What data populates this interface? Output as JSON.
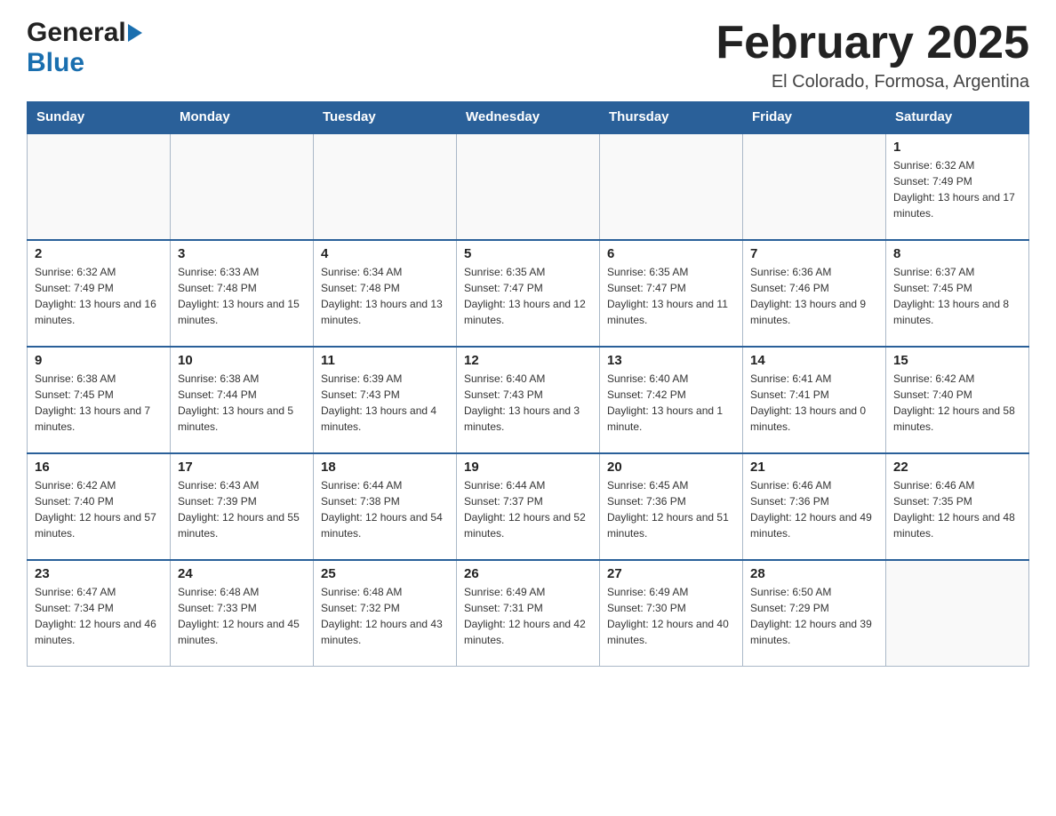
{
  "header": {
    "logo_general": "General",
    "logo_blue": "Blue",
    "month_title": "February 2025",
    "location": "El Colorado, Formosa, Argentina"
  },
  "weekdays": [
    "Sunday",
    "Monday",
    "Tuesday",
    "Wednesday",
    "Thursday",
    "Friday",
    "Saturday"
  ],
  "weeks": [
    [
      {
        "day": "",
        "sunrise": "",
        "sunset": "",
        "daylight": ""
      },
      {
        "day": "",
        "sunrise": "",
        "sunset": "",
        "daylight": ""
      },
      {
        "day": "",
        "sunrise": "",
        "sunset": "",
        "daylight": ""
      },
      {
        "day": "",
        "sunrise": "",
        "sunset": "",
        "daylight": ""
      },
      {
        "day": "",
        "sunrise": "",
        "sunset": "",
        "daylight": ""
      },
      {
        "day": "",
        "sunrise": "",
        "sunset": "",
        "daylight": ""
      },
      {
        "day": "1",
        "sunrise": "Sunrise: 6:32 AM",
        "sunset": "Sunset: 7:49 PM",
        "daylight": "Daylight: 13 hours and 17 minutes."
      }
    ],
    [
      {
        "day": "2",
        "sunrise": "Sunrise: 6:32 AM",
        "sunset": "Sunset: 7:49 PM",
        "daylight": "Daylight: 13 hours and 16 minutes."
      },
      {
        "day": "3",
        "sunrise": "Sunrise: 6:33 AM",
        "sunset": "Sunset: 7:48 PM",
        "daylight": "Daylight: 13 hours and 15 minutes."
      },
      {
        "day": "4",
        "sunrise": "Sunrise: 6:34 AM",
        "sunset": "Sunset: 7:48 PM",
        "daylight": "Daylight: 13 hours and 13 minutes."
      },
      {
        "day": "5",
        "sunrise": "Sunrise: 6:35 AM",
        "sunset": "Sunset: 7:47 PM",
        "daylight": "Daylight: 13 hours and 12 minutes."
      },
      {
        "day": "6",
        "sunrise": "Sunrise: 6:35 AM",
        "sunset": "Sunset: 7:47 PM",
        "daylight": "Daylight: 13 hours and 11 minutes."
      },
      {
        "day": "7",
        "sunrise": "Sunrise: 6:36 AM",
        "sunset": "Sunset: 7:46 PM",
        "daylight": "Daylight: 13 hours and 9 minutes."
      },
      {
        "day": "8",
        "sunrise": "Sunrise: 6:37 AM",
        "sunset": "Sunset: 7:45 PM",
        "daylight": "Daylight: 13 hours and 8 minutes."
      }
    ],
    [
      {
        "day": "9",
        "sunrise": "Sunrise: 6:38 AM",
        "sunset": "Sunset: 7:45 PM",
        "daylight": "Daylight: 13 hours and 7 minutes."
      },
      {
        "day": "10",
        "sunrise": "Sunrise: 6:38 AM",
        "sunset": "Sunset: 7:44 PM",
        "daylight": "Daylight: 13 hours and 5 minutes."
      },
      {
        "day": "11",
        "sunrise": "Sunrise: 6:39 AM",
        "sunset": "Sunset: 7:43 PM",
        "daylight": "Daylight: 13 hours and 4 minutes."
      },
      {
        "day": "12",
        "sunrise": "Sunrise: 6:40 AM",
        "sunset": "Sunset: 7:43 PM",
        "daylight": "Daylight: 13 hours and 3 minutes."
      },
      {
        "day": "13",
        "sunrise": "Sunrise: 6:40 AM",
        "sunset": "Sunset: 7:42 PM",
        "daylight": "Daylight: 13 hours and 1 minute."
      },
      {
        "day": "14",
        "sunrise": "Sunrise: 6:41 AM",
        "sunset": "Sunset: 7:41 PM",
        "daylight": "Daylight: 13 hours and 0 minutes."
      },
      {
        "day": "15",
        "sunrise": "Sunrise: 6:42 AM",
        "sunset": "Sunset: 7:40 PM",
        "daylight": "Daylight: 12 hours and 58 minutes."
      }
    ],
    [
      {
        "day": "16",
        "sunrise": "Sunrise: 6:42 AM",
        "sunset": "Sunset: 7:40 PM",
        "daylight": "Daylight: 12 hours and 57 minutes."
      },
      {
        "day": "17",
        "sunrise": "Sunrise: 6:43 AM",
        "sunset": "Sunset: 7:39 PM",
        "daylight": "Daylight: 12 hours and 55 minutes."
      },
      {
        "day": "18",
        "sunrise": "Sunrise: 6:44 AM",
        "sunset": "Sunset: 7:38 PM",
        "daylight": "Daylight: 12 hours and 54 minutes."
      },
      {
        "day": "19",
        "sunrise": "Sunrise: 6:44 AM",
        "sunset": "Sunset: 7:37 PM",
        "daylight": "Daylight: 12 hours and 52 minutes."
      },
      {
        "day": "20",
        "sunrise": "Sunrise: 6:45 AM",
        "sunset": "Sunset: 7:36 PM",
        "daylight": "Daylight: 12 hours and 51 minutes."
      },
      {
        "day": "21",
        "sunrise": "Sunrise: 6:46 AM",
        "sunset": "Sunset: 7:36 PM",
        "daylight": "Daylight: 12 hours and 49 minutes."
      },
      {
        "day": "22",
        "sunrise": "Sunrise: 6:46 AM",
        "sunset": "Sunset: 7:35 PM",
        "daylight": "Daylight: 12 hours and 48 minutes."
      }
    ],
    [
      {
        "day": "23",
        "sunrise": "Sunrise: 6:47 AM",
        "sunset": "Sunset: 7:34 PM",
        "daylight": "Daylight: 12 hours and 46 minutes."
      },
      {
        "day": "24",
        "sunrise": "Sunrise: 6:48 AM",
        "sunset": "Sunset: 7:33 PM",
        "daylight": "Daylight: 12 hours and 45 minutes."
      },
      {
        "day": "25",
        "sunrise": "Sunrise: 6:48 AM",
        "sunset": "Sunset: 7:32 PM",
        "daylight": "Daylight: 12 hours and 43 minutes."
      },
      {
        "day": "26",
        "sunrise": "Sunrise: 6:49 AM",
        "sunset": "Sunset: 7:31 PM",
        "daylight": "Daylight: 12 hours and 42 minutes."
      },
      {
        "day": "27",
        "sunrise": "Sunrise: 6:49 AM",
        "sunset": "Sunset: 7:30 PM",
        "daylight": "Daylight: 12 hours and 40 minutes."
      },
      {
        "day": "28",
        "sunrise": "Sunrise: 6:50 AM",
        "sunset": "Sunset: 7:29 PM",
        "daylight": "Daylight: 12 hours and 39 minutes."
      },
      {
        "day": "",
        "sunrise": "",
        "sunset": "",
        "daylight": ""
      }
    ]
  ],
  "colors": {
    "header_bg": "#2a6099",
    "header_text": "#ffffff",
    "border": "#aab8c8",
    "accent": "#1a6faf"
  }
}
